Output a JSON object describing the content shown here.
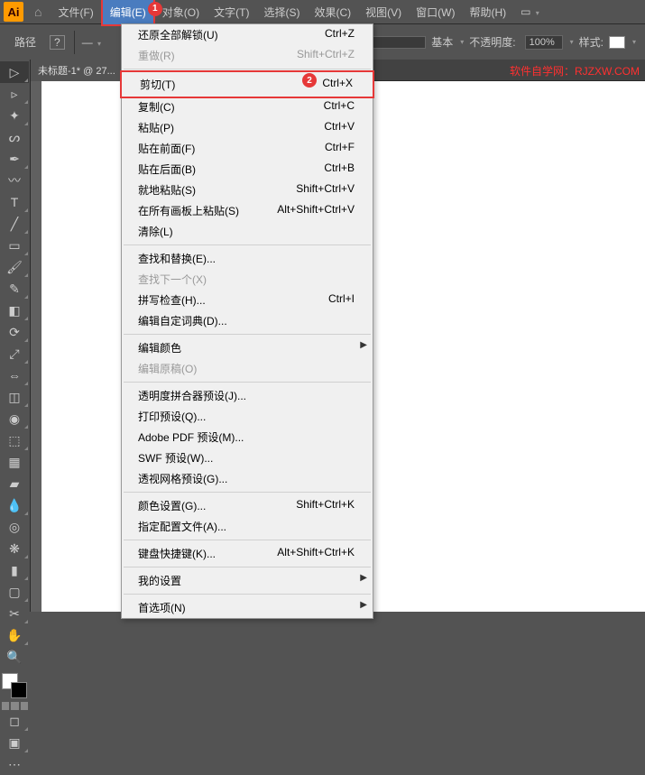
{
  "menubar": {
    "items": [
      "文件(F)",
      "编辑(E)",
      "对象(O)",
      "文字(T)",
      "选择(S)",
      "效果(C)",
      "视图(V)",
      "窗口(W)",
      "帮助(H)"
    ]
  },
  "optionbar": {
    "path_label": "路径",
    "basic_label": "基本",
    "opacity_label": "不透明度:",
    "opacity_value": "100%",
    "style_label": "样式:"
  },
  "tab": {
    "title": "未标题-1* @ 27..."
  },
  "watermark": "软件自学网：RJZXW.COM",
  "dropdown": {
    "items": [
      {
        "label": "还原全部解锁(U)",
        "shortcut": "Ctrl+Z",
        "type": "item"
      },
      {
        "label": "重做(R)",
        "shortcut": "Shift+Ctrl+Z",
        "type": "item",
        "disabled": true
      },
      {
        "type": "sep"
      },
      {
        "label": "剪切(T)",
        "shortcut": "Ctrl+X",
        "type": "item",
        "highlight": true,
        "marker": "2"
      },
      {
        "label": "复制(C)",
        "shortcut": "Ctrl+C",
        "type": "item"
      },
      {
        "label": "粘贴(P)",
        "shortcut": "Ctrl+V",
        "type": "item"
      },
      {
        "label": "贴在前面(F)",
        "shortcut": "Ctrl+F",
        "type": "item"
      },
      {
        "label": "贴在后面(B)",
        "shortcut": "Ctrl+B",
        "type": "item"
      },
      {
        "label": "就地粘贴(S)",
        "shortcut": "Shift+Ctrl+V",
        "type": "item"
      },
      {
        "label": "在所有画板上粘贴(S)",
        "shortcut": "Alt+Shift+Ctrl+V",
        "type": "item"
      },
      {
        "label": "清除(L)",
        "shortcut": "",
        "type": "item"
      },
      {
        "type": "sep"
      },
      {
        "label": "查找和替换(E)...",
        "shortcut": "",
        "type": "item"
      },
      {
        "label": "查找下一个(X)",
        "shortcut": "",
        "type": "item",
        "disabled": true
      },
      {
        "label": "拼写检查(H)...",
        "shortcut": "Ctrl+I",
        "type": "item"
      },
      {
        "label": "编辑自定词典(D)...",
        "shortcut": "",
        "type": "item"
      },
      {
        "type": "sep"
      },
      {
        "label": "编辑颜色",
        "shortcut": "",
        "type": "item",
        "submenu": true
      },
      {
        "label": "编辑原稿(O)",
        "shortcut": "",
        "type": "item",
        "disabled": true
      },
      {
        "type": "sep"
      },
      {
        "label": "透明度拼合器预设(J)...",
        "shortcut": "",
        "type": "item"
      },
      {
        "label": "打印预设(Q)...",
        "shortcut": "",
        "type": "item"
      },
      {
        "label": "Adobe PDF 预设(M)...",
        "shortcut": "",
        "type": "item"
      },
      {
        "label": "SWF 预设(W)...",
        "shortcut": "",
        "type": "item"
      },
      {
        "label": "透视网格预设(G)...",
        "shortcut": "",
        "type": "item"
      },
      {
        "type": "sep"
      },
      {
        "label": "颜色设置(G)...",
        "shortcut": "Shift+Ctrl+K",
        "type": "item"
      },
      {
        "label": "指定配置文件(A)...",
        "shortcut": "",
        "type": "item"
      },
      {
        "type": "sep"
      },
      {
        "label": "键盘快捷键(K)...",
        "shortcut": "Alt+Shift+Ctrl+K",
        "type": "item"
      },
      {
        "type": "sep"
      },
      {
        "label": "我的设置",
        "shortcut": "",
        "type": "item",
        "submenu": true
      },
      {
        "type": "sep"
      },
      {
        "label": "首选项(N)",
        "shortcut": "",
        "type": "item",
        "submenu": true
      }
    ]
  },
  "markers": {
    "m1": "1",
    "m2": "2"
  }
}
